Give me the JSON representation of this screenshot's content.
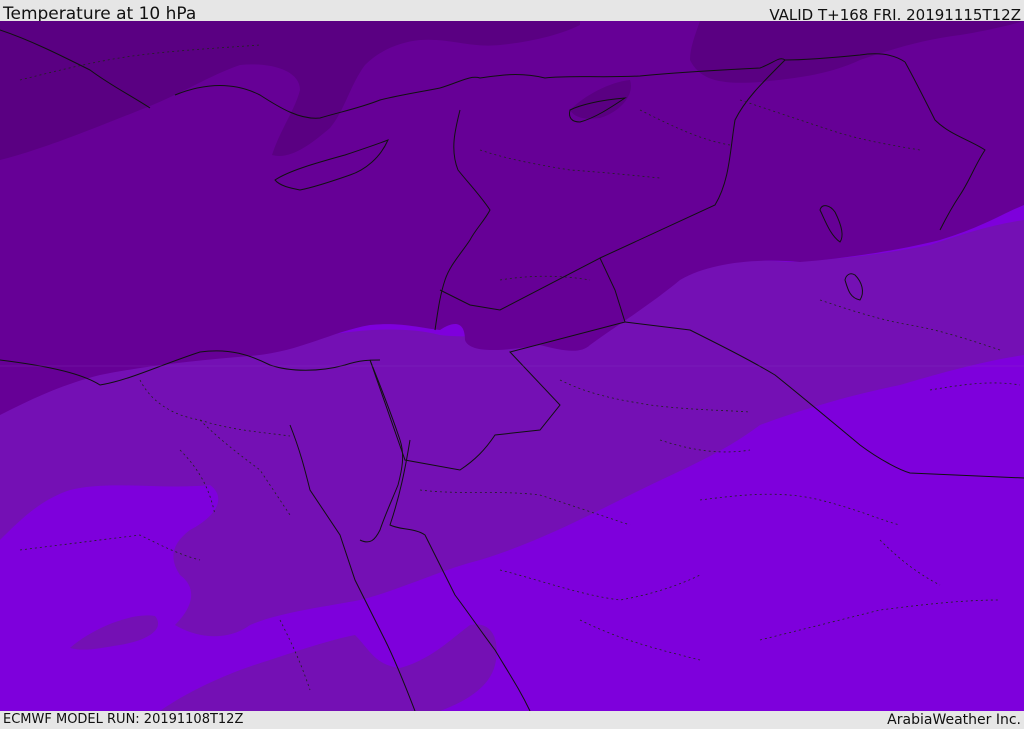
{
  "header": {
    "title": "Temperature at 10 hPa",
    "valid_time": "VALID T+168 FRI. 20191115T12Z"
  },
  "footer": {
    "model_run": "ECMWF MODEL RUN: 20191108T12Z",
    "credit": "ArabiaWeather Inc."
  },
  "map": {
    "field": "temperature",
    "level": "10 hPa",
    "region": "Eastern Mediterranean / Middle East",
    "colors": {
      "band_coldest": "#5a0082",
      "band_cold": "#660096",
      "band_mid": "#7410b4",
      "band_warm": "#7e00dc",
      "border_line": "#111111"
    }
  }
}
